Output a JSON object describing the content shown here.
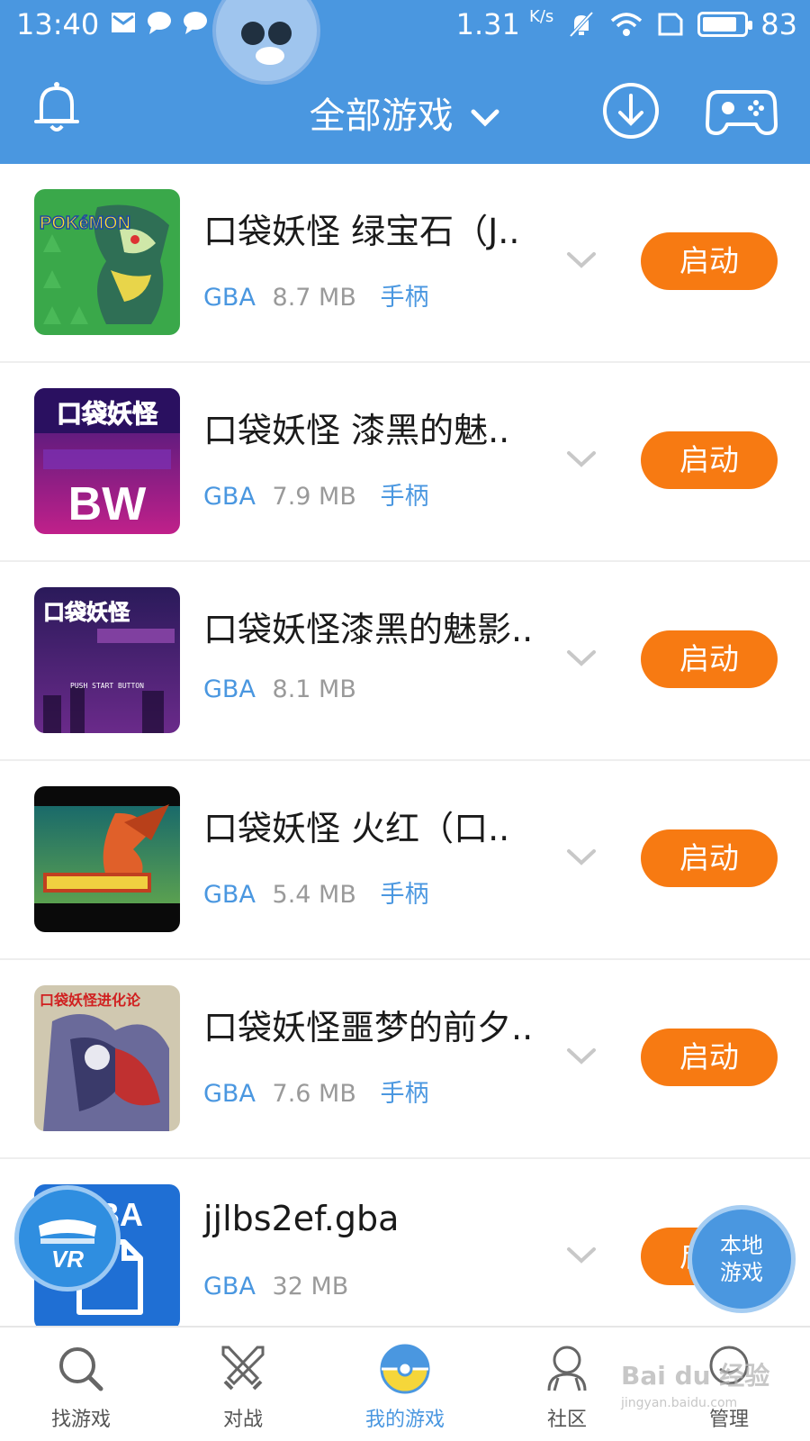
{
  "status_bar": {
    "time": "13:40",
    "net_speed": "1.31",
    "net_unit": "K/s",
    "battery": "83",
    "battery_level": 0.83
  },
  "header": {
    "title": "全部游戏",
    "bell_icon": "bell-icon",
    "download_icon": "download-icon",
    "gamepad_icon": "gamepad-icon"
  },
  "games": [
    {
      "name": "口袋妖怪 绿宝石（J..",
      "platform": "GBA",
      "size": "8.7 MB",
      "controller": "手柄",
      "button": "启动"
    },
    {
      "name": "口袋妖怪 漆黑的魅..",
      "platform": "GBA",
      "size": "7.9 MB",
      "controller": "手柄",
      "button": "启动"
    },
    {
      "name": "口袋妖怪漆黑的魅影..",
      "platform": "GBA",
      "size": "8.1 MB",
      "controller": "",
      "button": "启动"
    },
    {
      "name": "口袋妖怪 火红（口..",
      "platform": "GBA",
      "size": "5.4 MB",
      "controller": "手柄",
      "button": "启动"
    },
    {
      "name": "口袋妖怪噩梦的前夕..",
      "platform": "GBA",
      "size": "7.6 MB",
      "controller": "手柄",
      "button": "启动"
    },
    {
      "name": "jjlbs2ef.gba",
      "platform": "GBA",
      "size": "32 MB",
      "controller": "",
      "button": "启动"
    }
  ],
  "thumbs": {
    "t1_label": "POKéMON",
    "t2_label": "口袋妖怪",
    "t2_big": "BW",
    "t3_label": "口袋妖怪",
    "t3_press": "PUSH START BUTTON",
    "t5_label": "口袋妖怪进化论",
    "t6_label": "GBA"
  },
  "fab": {
    "vr_label": "VR",
    "local_line1": "本地",
    "local_line2": "游戏"
  },
  "bottom_nav": [
    {
      "label": "找游戏",
      "icon": "search-icon"
    },
    {
      "label": "对战",
      "icon": "swords-icon"
    },
    {
      "label": "我的游戏",
      "icon": "pokeball-icon"
    },
    {
      "label": "社区",
      "icon": "community-icon"
    },
    {
      "label": "管理",
      "icon": "manage-icon"
    }
  ],
  "watermark": {
    "text": "Bai du 经验",
    "url": "jingyan.baidu.com"
  },
  "colors": {
    "header_bg": "#4a97e0",
    "accent_blue": "#4a97e0",
    "launch_orange": "#f77a12"
  }
}
